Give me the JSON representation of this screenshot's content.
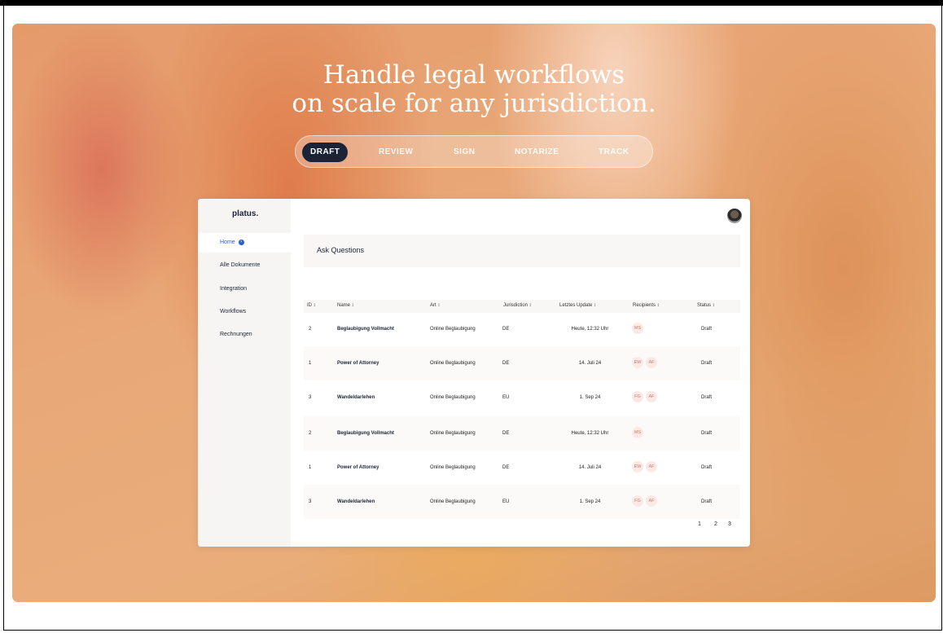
{
  "hero": {
    "headline_line1": "Handle legal workflows",
    "headline_line2": "on scale for any jurisdiction."
  },
  "tabs": [
    {
      "label": "DRAFT",
      "active": true
    },
    {
      "label": "REVIEW",
      "active": false
    },
    {
      "label": "SIGN",
      "active": false
    },
    {
      "label": "NOTARIZE",
      "active": false
    },
    {
      "label": "TRACK",
      "active": false
    }
  ],
  "app": {
    "logo": "platus.",
    "nav": [
      {
        "label": "Home",
        "active": true
      },
      {
        "label": "Alle Dokumente",
        "active": false
      },
      {
        "label": "Integration",
        "active": false
      },
      {
        "label": "Workflows",
        "active": false
      },
      {
        "label": "Rechnungen",
        "active": false
      }
    ],
    "ask_questions": "Ask Questions",
    "columns": [
      "ID ↕",
      "Name ↕",
      "Art ↕",
      "Jurisdiction ↕",
      "Letztes Update ↕",
      "Recipients ↕",
      "Status ↕"
    ],
    "rows": [
      {
        "id": "2",
        "name": "Beglaubigung Vollmacht",
        "art": "Online Beglaubigung",
        "jurisdiction": "DE",
        "update": "Heute, 12:32 Uhr",
        "recipients": [
          "MS"
        ],
        "status": "Draft"
      },
      {
        "id": "1",
        "name": "Power of Attorney",
        "art": "Online Beglaubigung",
        "jurisdiction": "DE",
        "update": "14. Juli 24",
        "recipients": [
          "EW",
          "AF"
        ],
        "status": "Draft"
      },
      {
        "id": "3",
        "name": "Wandeldarlehen",
        "art": "Online Beglaubigung",
        "jurisdiction": "EU",
        "update": "1. Sep 24",
        "recipients": [
          "FG",
          "AF"
        ],
        "status": "Draft"
      },
      {
        "id": "2",
        "name": "Beglaubigung Vollmacht",
        "art": "Online Beglaubigung",
        "jurisdiction": "DE",
        "update": "Heute, 12:32 Uhr",
        "recipients": [
          "MS"
        ],
        "status": "Draft"
      },
      {
        "id": "1",
        "name": "Power of Attorney",
        "art": "Online Beglaubigung",
        "jurisdiction": "DE",
        "update": "14. Juli 24",
        "recipients": [
          "EW",
          "AF"
        ],
        "status": "Draft"
      },
      {
        "id": "3",
        "name": "Wandeldarlehen",
        "art": "Online Beglaubigung",
        "jurisdiction": "EU",
        "update": "1. Sep 24",
        "recipients": [
          "FG",
          "AF"
        ],
        "status": "Draft"
      }
    ],
    "pagination": [
      "1",
      "2",
      "3"
    ]
  },
  "colors": {
    "accent": "#2a5bd7",
    "dark": "#1b2436",
    "chip_bg": "#fbe9e6",
    "chip_text": "#d27c6e"
  },
  "icons": {
    "home_badge": "chevron-right-icon",
    "avatar": "user-avatar"
  }
}
